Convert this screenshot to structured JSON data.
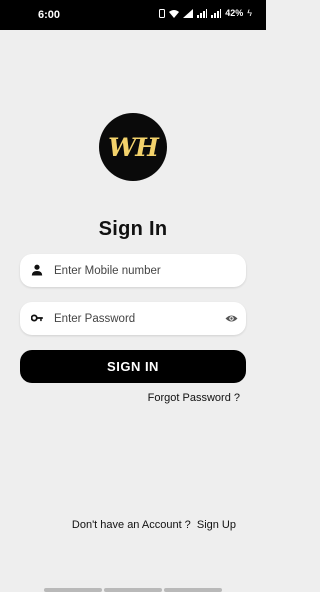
{
  "status_bar": {
    "time": "6:00",
    "battery": "42%",
    "icons": [
      "vibrate-icon",
      "wifi-icon",
      "volte-icon",
      "signal-icon",
      "signal-icon",
      "battery-charging-icon"
    ]
  },
  "logo": {
    "text": "WH"
  },
  "title": "Sign In",
  "form": {
    "mobile": {
      "placeholder": "Enter Mobile number",
      "value": "",
      "icon": "person-icon"
    },
    "password": {
      "placeholder": "Enter Password",
      "value": "",
      "icon": "key-icon",
      "toggle_icon": "eye-icon"
    },
    "submit_label": "SIGN IN",
    "forgot_label": "Forgot Password ?"
  },
  "footer": {
    "prompt": "Don't have an Account ?",
    "signup_label": "Sign Up"
  },
  "colors": {
    "background": "#eeeeee",
    "primary": "#000000",
    "logo_accent": "#f3d26b"
  }
}
